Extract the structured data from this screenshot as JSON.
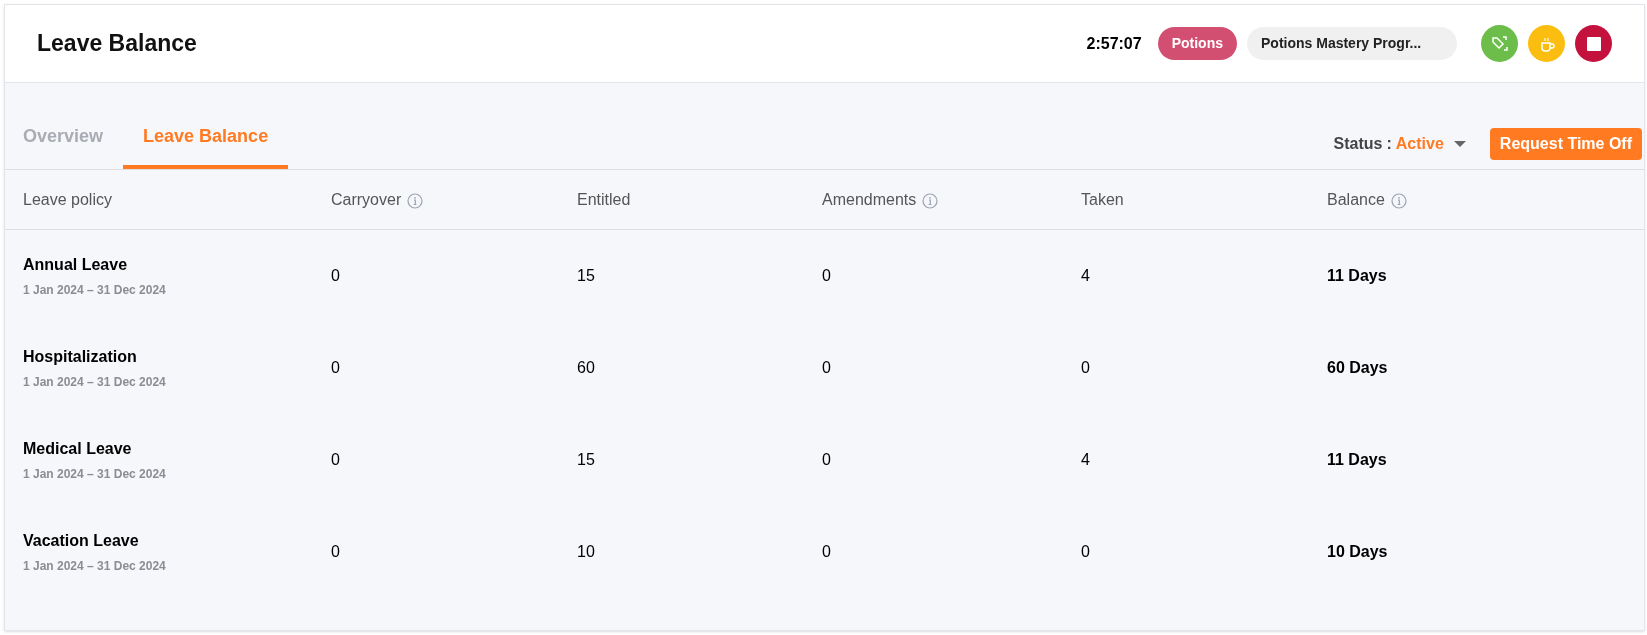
{
  "header": {
    "title": "Leave Balance",
    "timer": "2:57:07",
    "tag": "Potions",
    "program": "Potions Mastery Progr..."
  },
  "tabs": [
    {
      "label": "Overview",
      "selected": false
    },
    {
      "label": "Leave Balance",
      "selected": true
    }
  ],
  "status": {
    "label": "Status",
    "separator": ":",
    "value": "Active"
  },
  "request_button": "Request Time Off",
  "table": {
    "columns": [
      {
        "label": "Leave policy",
        "info": false
      },
      {
        "label": "Carryover",
        "info": true
      },
      {
        "label": "Entitled",
        "info": false
      },
      {
        "label": "Amendments",
        "info": true
      },
      {
        "label": "Taken",
        "info": false
      },
      {
        "label": "Balance",
        "info": true
      }
    ],
    "rows": [
      {
        "policy": "Annual Leave",
        "period": "1 Jan 2024 – 31 Dec 2024",
        "carryover": "0",
        "entitled": "15",
        "amendments": "0",
        "taken": "4",
        "balance": "11 Days"
      },
      {
        "policy": "Hospitalization",
        "period": "1 Jan 2024 – 31 Dec 2024",
        "carryover": "0",
        "entitled": "60",
        "amendments": "0",
        "taken": "0",
        "balance": "60 Days"
      },
      {
        "policy": "Medical Leave",
        "period": "1 Jan 2024 – 31 Dec 2024",
        "carryover": "0",
        "entitled": "15",
        "amendments": "0",
        "taken": "4",
        "balance": "11 Days"
      },
      {
        "policy": "Vacation Leave",
        "period": "1 Jan 2024 – 31 Dec 2024",
        "carryover": "0",
        "entitled": "10",
        "amendments": "0",
        "taken": "0",
        "balance": "10 Days"
      }
    ]
  }
}
